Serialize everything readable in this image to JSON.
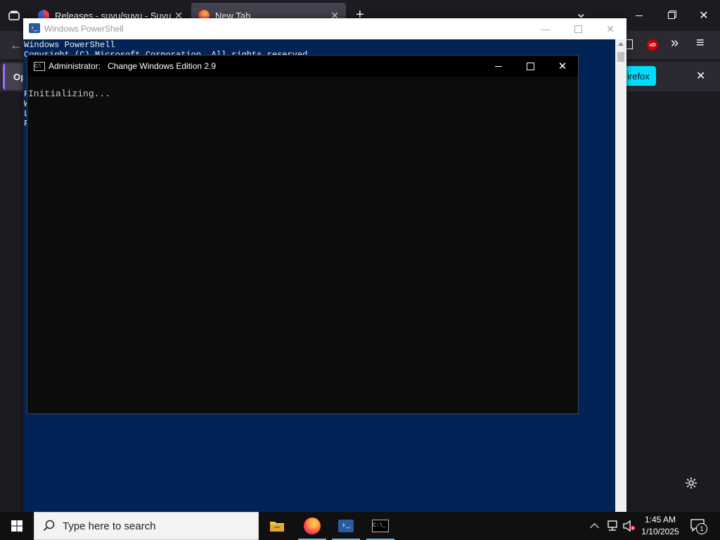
{
  "firefox": {
    "tabs": [
      {
        "title": "Releases - suvu/suvu - Suvu Git",
        "close": "✕"
      },
      {
        "title": "New Tab",
        "close": "✕"
      }
    ],
    "new_tab": "+",
    "list_tabs": "⌄",
    "notification": {
      "left_text": "Op",
      "right_text": "irefox",
      "close": "✕"
    },
    "extensions_more": "»",
    "menu": "≡",
    "ublock_label": "uD"
  },
  "powershell": {
    "title": "Windows PowerShell",
    "lines": [
      "Windows PowerShell",
      "Copyright (C) Microsoft Corporation. All rights reserved."
    ],
    "left_chars": [
      "F",
      "W",
      "L",
      "F"
    ]
  },
  "cmd": {
    "title_prefix": "Administrator:",
    "title": "Change Windows Edition 2.9",
    "output": "Initializing..."
  },
  "taskbar": {
    "search_placeholder": "Type here to search",
    "time": "1:45 AM",
    "date": "1/10/2025",
    "notification_count": "1"
  },
  "colors": {
    "ps_background": "#012456",
    "cmd_background": "#0c0c0c",
    "firefox_dark": "#1c1b22",
    "accent": "#00ddff"
  }
}
